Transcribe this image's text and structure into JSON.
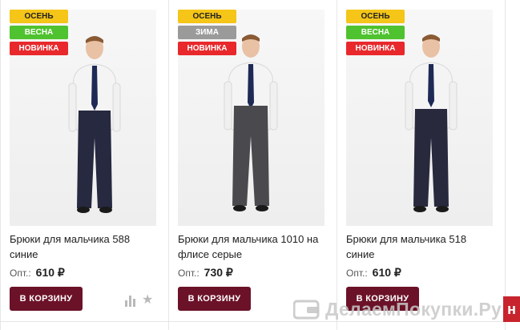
{
  "products": [
    {
      "badges": [
        {
          "label": "ОСЕНЬ",
          "kind": "autumn"
        },
        {
          "label": "ВЕСНА",
          "kind": "spring"
        },
        {
          "label": "НОВИНКА",
          "kind": "new"
        }
      ],
      "name": "Брюки для мальчика 588 синие",
      "price_label": "Опт.:",
      "price": "610 ₽",
      "cart_label": "В КОРЗИНУ",
      "trouser_color": "#26293f"
    },
    {
      "badges": [
        {
          "label": "ОСЕНЬ",
          "kind": "autumn"
        },
        {
          "label": "ЗИМА",
          "kind": "winter"
        },
        {
          "label": "НОВИНКА",
          "kind": "new"
        }
      ],
      "name": "Брюки для мальчика 1010 на флисе серые",
      "price_label": "Опт.:",
      "price": "730 ₽",
      "cart_label": "В КОРЗИНУ",
      "trouser_color": "#4a4a4e"
    },
    {
      "badges": [
        {
          "label": "ОСЕНЬ",
          "kind": "autumn"
        },
        {
          "label": "ВЕСНА",
          "kind": "spring"
        },
        {
          "label": "НОВИНКА",
          "kind": "new"
        }
      ],
      "name": "Брюки для мальчика 518 синие",
      "price_label": "Опт.:",
      "price": "610 ₽",
      "cart_label": "В КОРЗИНУ",
      "trouser_color": "#28293d"
    }
  ],
  "icons": {
    "compare": "bar-chart-icon",
    "favorite": "star-icon"
  },
  "watermark": {
    "text": "ДелаемПокупки.Ру"
  },
  "colors": {
    "cart_button": "#6b1228",
    "autumn": "#f5c518",
    "spring": "#4fc22f",
    "winter": "#9a9a9a",
    "new": "#e8282b"
  }
}
